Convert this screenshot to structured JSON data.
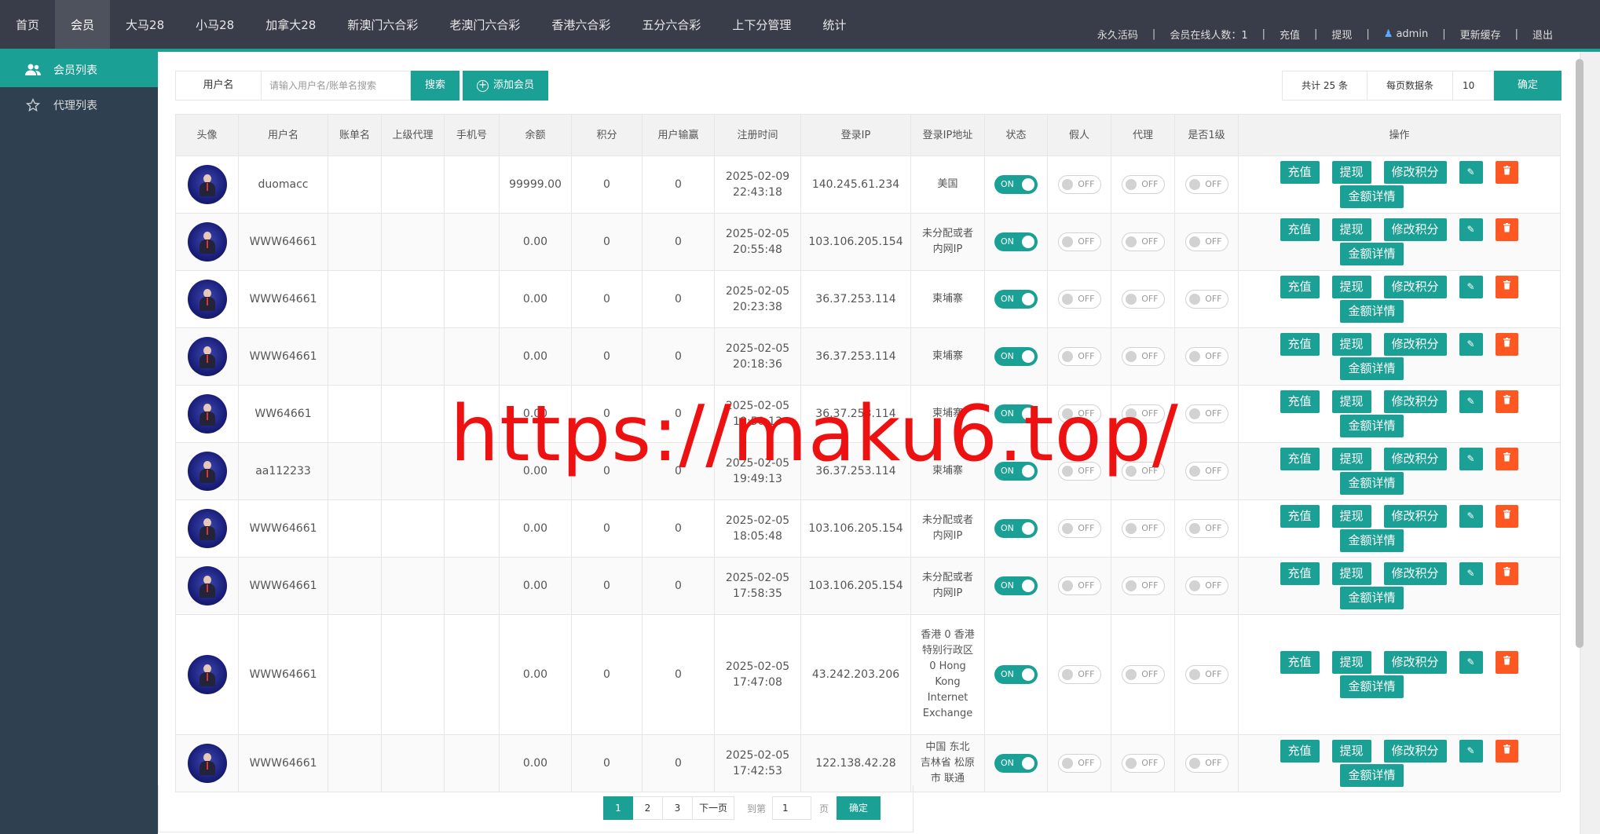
{
  "topnav": {
    "items": [
      "首页",
      "会员",
      "大马28",
      "小马28",
      "加拿大28",
      "新澳门六合彩",
      "老澳门六合彩",
      "香港六合彩",
      "五分六合彩",
      "上下分管理",
      "统计"
    ],
    "active_index": 1
  },
  "topright": {
    "activate": "永久活码",
    "online": "会员在线人数：1",
    "recharge": "充值",
    "withdraw": "提现",
    "user": "admin",
    "clear_cache": "更新缓存",
    "logout": "退出"
  },
  "sidebar": {
    "items": [
      {
        "label": "会员列表",
        "icon": "users-icon",
        "active": true
      },
      {
        "label": "代理列表",
        "icon": "star-icon",
        "active": false
      }
    ]
  },
  "toolbar": {
    "username_label": "用户名",
    "search_placeholder": "请输入用户名/账单名搜索",
    "search_button": "搜索",
    "add_button": "添加会员"
  },
  "paginfo": {
    "total": "共计 25 条",
    "per_page_label": "每页数据条",
    "per_page_value": "10",
    "confirm": "确定"
  },
  "table": {
    "headers": [
      "头像",
      "用户名",
      "账单名",
      "上级代理",
      "手机号",
      "余额",
      "积分",
      "用户输赢",
      "注册时间",
      "登录IP",
      "登录IP地址",
      "状态",
      "假人",
      "代理",
      "是否1级",
      "操作"
    ],
    "rows": [
      {
        "username": "duomacc",
        "balance": "99999.00",
        "points": "0",
        "winloss": "0",
        "reg_date": "2025-02-09",
        "reg_time": "22:43:18",
        "ip": "140.245.61.234",
        "location": "美国",
        "status": "ON"
      },
      {
        "username": "WWW64661",
        "balance": "0.00",
        "points": "0",
        "winloss": "0",
        "reg_date": "2025-02-05",
        "reg_time": "20:55:48",
        "ip": "103.106.205.154",
        "location": "未分配或者内网IP",
        "status": "ON"
      },
      {
        "username": "WWW64661",
        "balance": "0.00",
        "points": "0",
        "winloss": "0",
        "reg_date": "2025-02-05",
        "reg_time": "20:23:38",
        "ip": "36.37.253.114",
        "location": "柬埔寨",
        "status": "ON"
      },
      {
        "username": "WWW64661",
        "balance": "0.00",
        "points": "0",
        "winloss": "0",
        "reg_date": "2025-02-05",
        "reg_time": "20:18:36",
        "ip": "36.37.253.114",
        "location": "柬埔寨",
        "status": "ON"
      },
      {
        "username": "WW64661",
        "balance": "0.00",
        "points": "0",
        "winloss": "0",
        "reg_date": "2025-02-05",
        "reg_time": "19:50:13",
        "ip": "36.37.253.114",
        "location": "柬埔寨",
        "status": "ON"
      },
      {
        "username": "aa112233",
        "balance": "0.00",
        "points": "0",
        "winloss": "0",
        "reg_date": "2025-02-05",
        "reg_time": "19:49:13",
        "ip": "36.37.253.114",
        "location": "柬埔寨",
        "status": "ON"
      },
      {
        "username": "WWW64661",
        "balance": "0.00",
        "points": "0",
        "winloss": "0",
        "reg_date": "2025-02-05",
        "reg_time": "18:05:48",
        "ip": "103.106.205.154",
        "location": "未分配或者内网IP",
        "status": "ON"
      },
      {
        "username": "WWW64661",
        "balance": "0.00",
        "points": "0",
        "winloss": "0",
        "reg_date": "2025-02-05",
        "reg_time": "17:58:35",
        "ip": "103.106.205.154",
        "location": "未分配或者内网IP",
        "status": "ON"
      },
      {
        "username": "WWW64661",
        "balance": "0.00",
        "points": "0",
        "winloss": "0",
        "reg_date": "2025-02-05",
        "reg_time": "17:47:08",
        "ip": "43.242.203.206",
        "location": "香港 0 香港特别行政区 0 Hong Kong Internet Exchange",
        "status": "ON"
      },
      {
        "username": "WWW64661",
        "balance": "0.00",
        "points": "0",
        "winloss": "0",
        "reg_date": "2025-02-05",
        "reg_time": "17:42:53",
        "ip": "122.138.42.28",
        "location": "中国 东北 吉林省 松原市 联通",
        "status": "ON"
      }
    ],
    "off_label": "OFF",
    "actions": {
      "recharge": "充值",
      "withdraw": "提现",
      "edit_points": "修改积分",
      "amount_detail": "金额详情"
    }
  },
  "pager": {
    "pages": [
      "1",
      "2",
      "3"
    ],
    "next": "下一页",
    "goto_label": "到第",
    "goto_value": "1",
    "page_unit": "页",
    "confirm": "确定"
  },
  "watermark": "https://maku6.top/",
  "colors": {
    "topbar": "#393d49",
    "accent": "#1aa094",
    "sidebar": "#2f4050",
    "danger": "#ff5722",
    "watermark": "#ee1111"
  }
}
